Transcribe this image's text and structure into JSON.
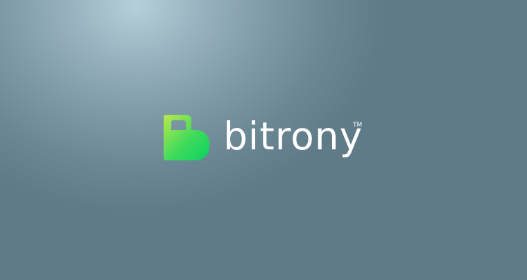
{
  "brand": {
    "name": "bitrony",
    "trademark": "TM",
    "mark_icon": "padlock-b-logo-icon",
    "colors": {
      "background": "#5f7b88",
      "glow": "#b6cfd9",
      "mark_light": "#b9e84c",
      "mark_dark": "#08d15f",
      "wordmark": "#ffffff"
    }
  }
}
